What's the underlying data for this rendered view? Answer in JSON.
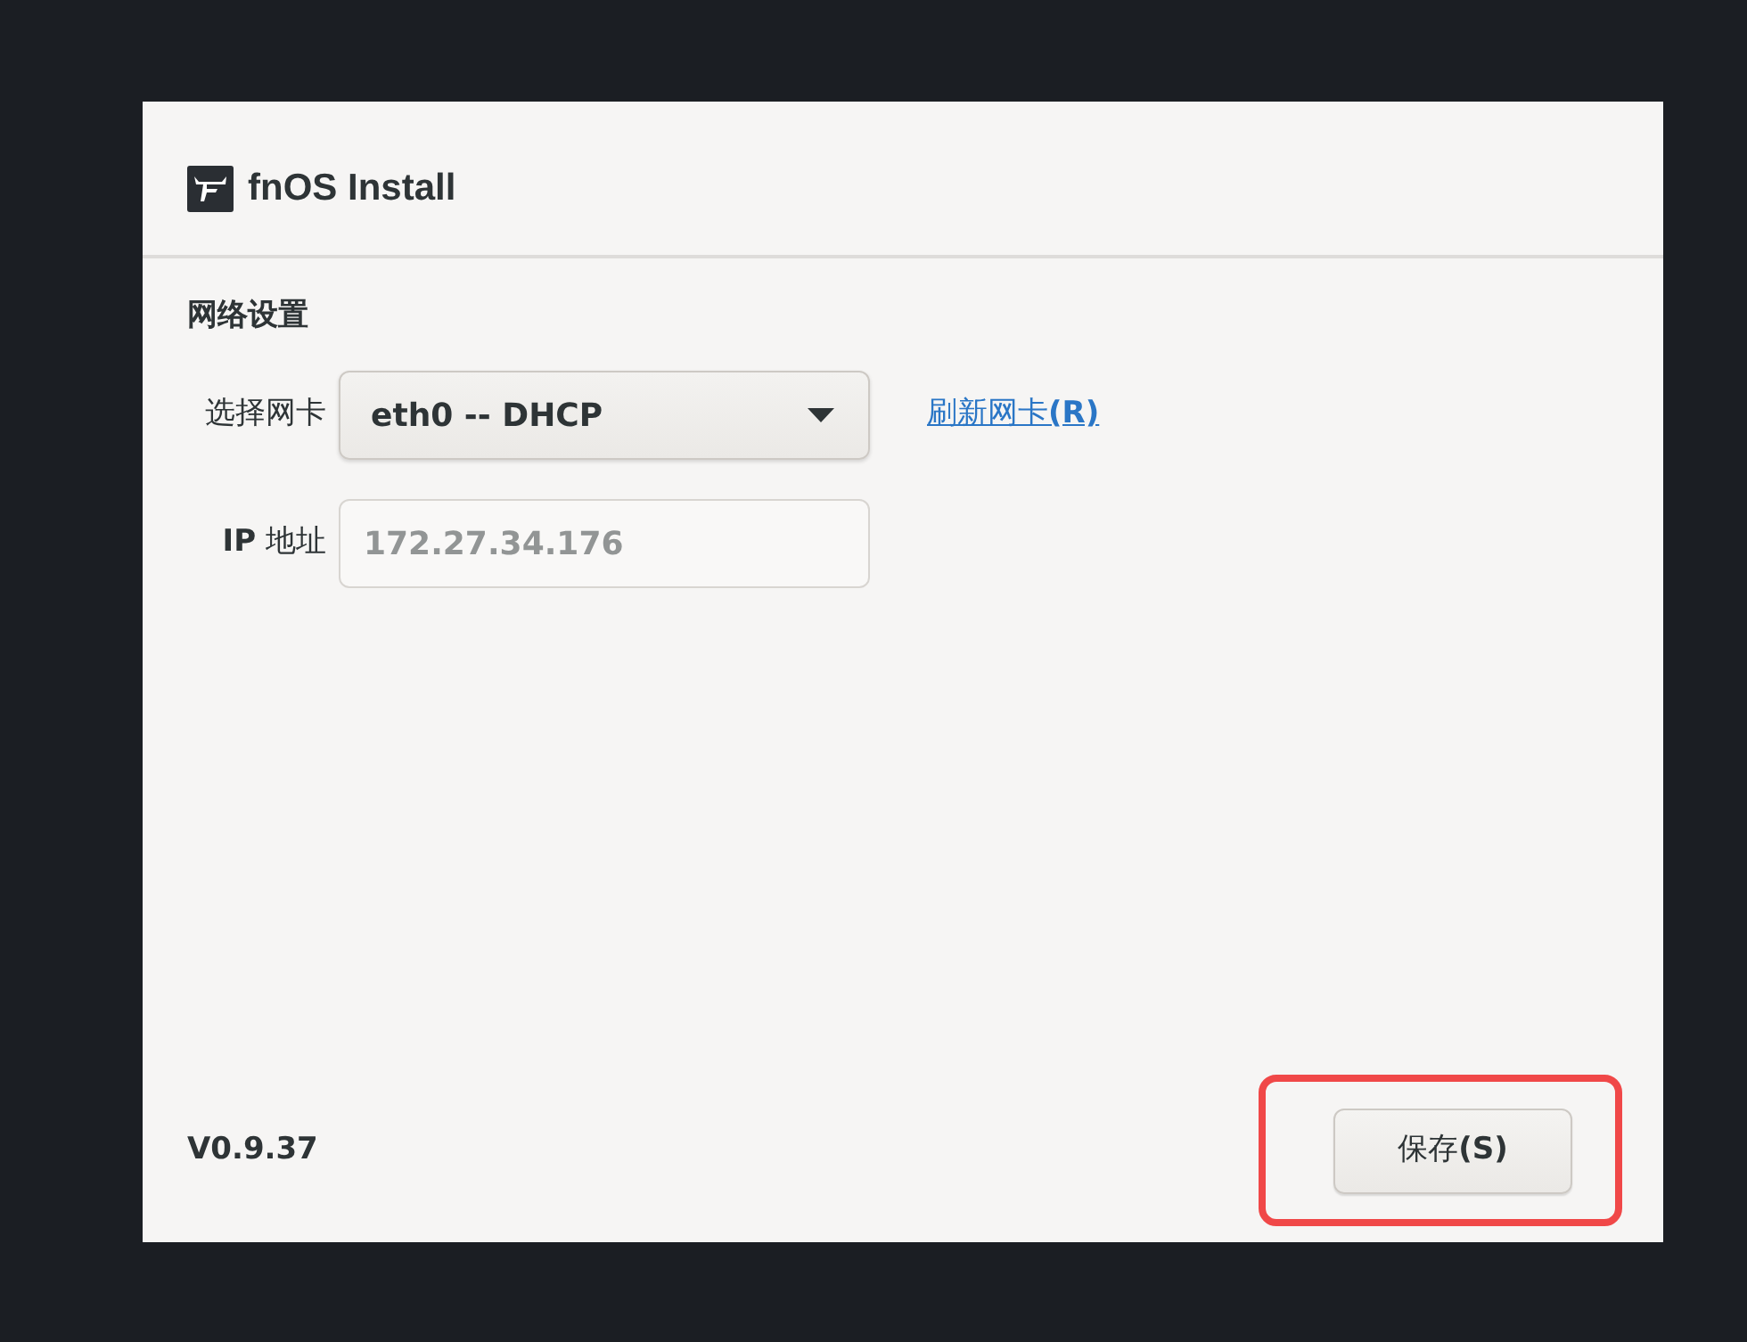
{
  "window": {
    "title": "fnOS Install"
  },
  "section": {
    "title": "网络设置"
  },
  "network_card": {
    "label": "选择网卡",
    "value": "eth0 -- DHCP",
    "link": "刷新网卡**(R)**"
  },
  "ip_address": {
    "label": "**IP** 地址",
    "value": "172.27.34.176",
    "disabled": true
  },
  "footer": {
    "version": "V0.9.37",
    "save_button": {
      "label": "保存**(S)**",
      "highlighted": true
    }
  }
}
